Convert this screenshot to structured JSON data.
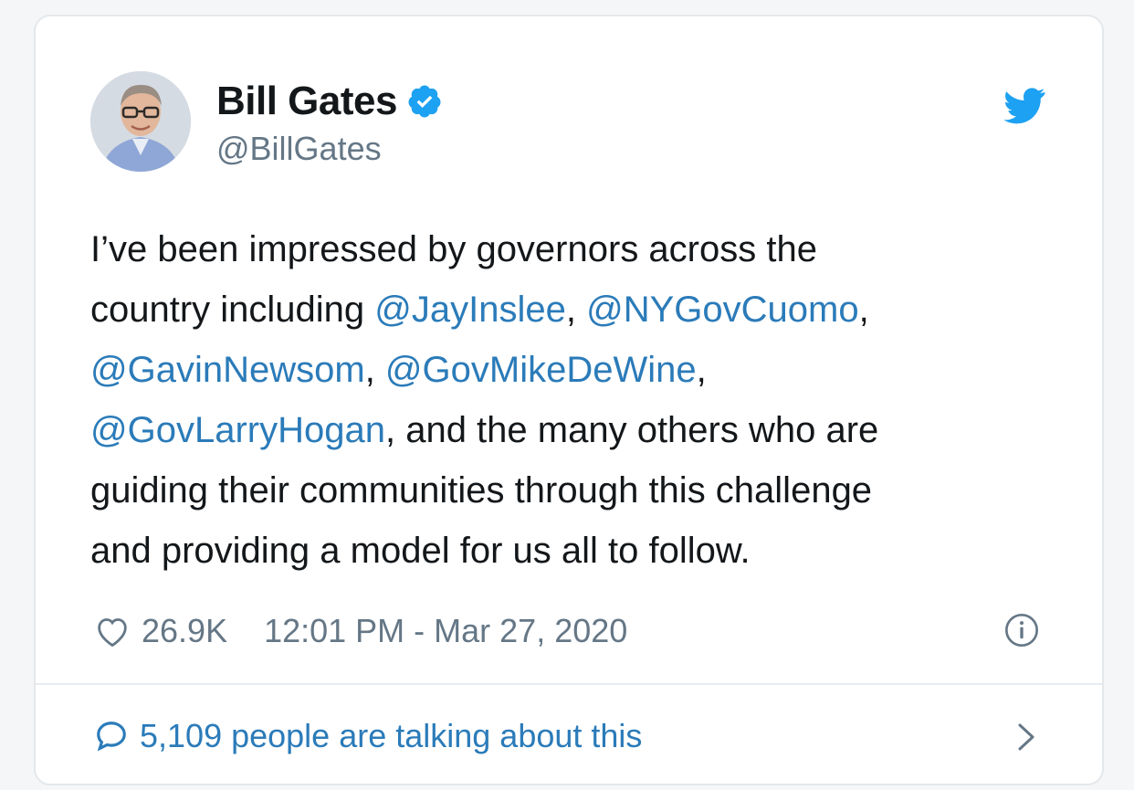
{
  "tweet": {
    "author": {
      "display_name": "Bill Gates",
      "handle": "@BillGates",
      "verified": true,
      "avatar_icon": "profile-photo"
    },
    "text": {
      "line1": "I’ve been impressed by governors across the",
      "line2_prefix": "country including ",
      "mention1": "@JayInslee",
      "sep1": ", ",
      "mention2": "@NYGovCuomo",
      "sep2": ",",
      "mention3": "@GavinNewsom",
      "sep3": ", ",
      "mention4": "@GovMikeDeWine",
      "sep4": ",",
      "mention5": "@GovLarryHogan",
      "line4_suffix": ", and the many others who are",
      "line5": "guiding their communities through this challenge",
      "line6": "and providing a model for us all to follow."
    },
    "likes": "26.9K",
    "timestamp": "12:01 PM - Mar 27, 2020",
    "footer_text": "5,109 people are talking about this"
  },
  "icons": {
    "verified": "verified-badge-icon",
    "brand": "twitter-bird-icon",
    "like": "heart-icon",
    "info": "info-icon",
    "comment": "speech-bubble-icon",
    "chevron": "chevron-right-icon"
  },
  "colors": {
    "link": "#2b7bb9",
    "brand": "#1da1f2",
    "text": "#14171a",
    "muted": "#657786"
  }
}
